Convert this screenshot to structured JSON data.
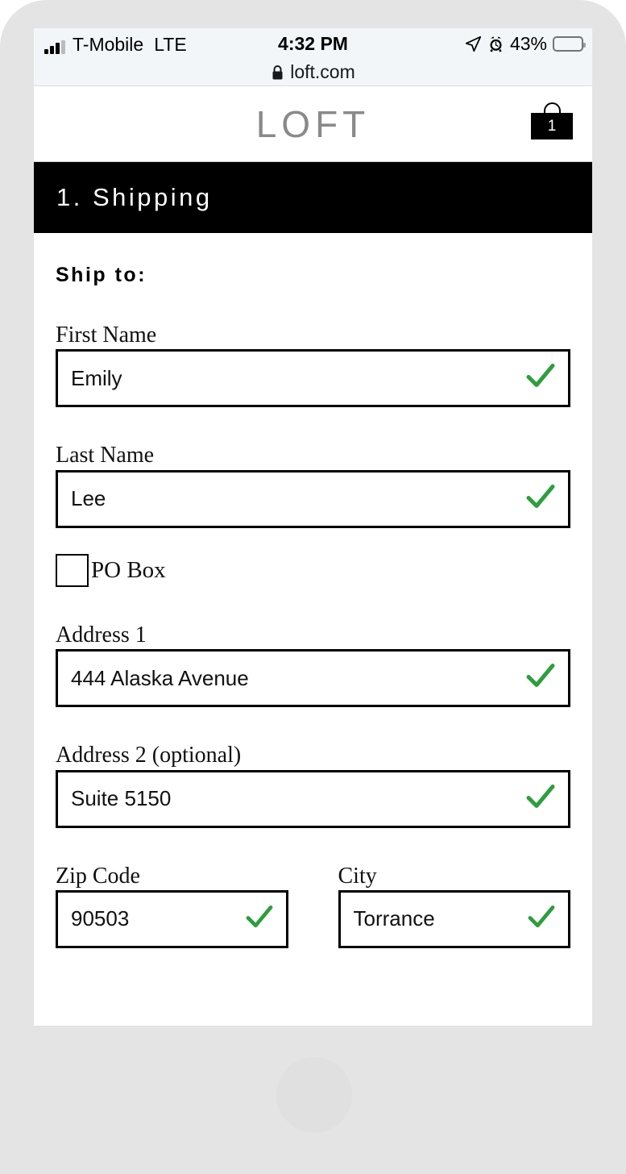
{
  "status_bar": {
    "carrier": "T-Mobile",
    "network": "LTE",
    "time": "4:32 PM",
    "battery_percent": "43%",
    "battery_level": 43,
    "battery_color": "#fcc400",
    "icons": [
      "signal-bars-icon",
      "location-arrow-icon",
      "alarm-clock-icon",
      "battery-icon"
    ]
  },
  "browser": {
    "lock_icon": "lock-icon",
    "url": "loft.com"
  },
  "site_header": {
    "logo": "LOFT",
    "bag_icon": "shopping-bag-icon",
    "bag_count": "1"
  },
  "checkout": {
    "step_title": "1. Shipping",
    "section_heading": "Ship to:",
    "valid_icon": "green-checkmark-icon",
    "valid_color": "#2e9e3e",
    "fields": [
      {
        "label": "First Name",
        "value": "Emily",
        "valid": true
      },
      {
        "label": "Last Name",
        "value": "Lee",
        "valid": true
      }
    ],
    "po_box": {
      "label": "PO Box",
      "checked": false
    },
    "address_fields": [
      {
        "label": "Address 1",
        "value": "444 Alaska Avenue",
        "valid": true
      },
      {
        "label": "Address 2 (optional)",
        "value": "Suite 5150",
        "valid": true
      }
    ],
    "city_zip": [
      {
        "label": "Zip Code",
        "value": "90503",
        "valid": true
      },
      {
        "label": "City",
        "value": "Torrance",
        "valid": true
      }
    ]
  }
}
